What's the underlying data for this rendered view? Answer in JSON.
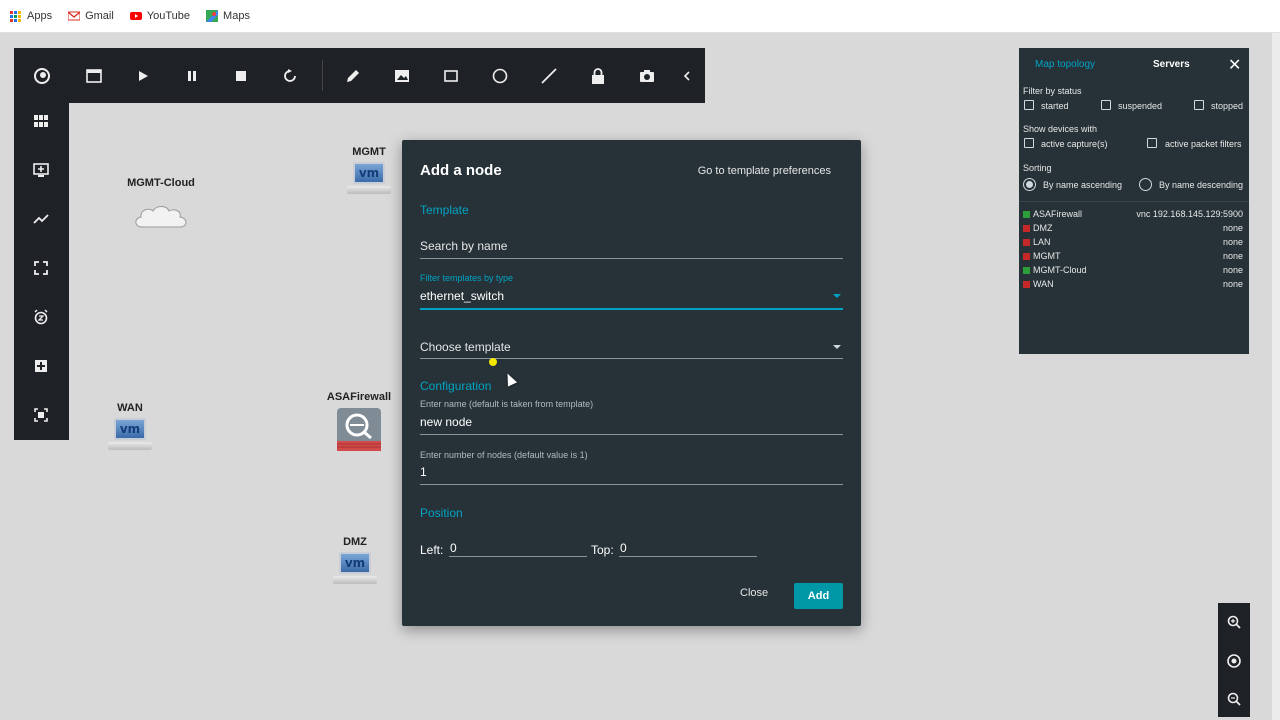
{
  "bookmarks": [
    {
      "label": "Apps",
      "icon": "apps-grid-icon"
    },
    {
      "label": "Gmail",
      "icon": "gmail-icon"
    },
    {
      "label": "YouTube",
      "icon": "youtube-icon"
    },
    {
      "label": "Maps",
      "icon": "maps-icon"
    }
  ],
  "toolbar": {
    "buttons": [
      "gns3-logo-icon",
      "console-window-icon",
      "play-icon",
      "pause-icon",
      "stop-icon",
      "reload-icon",
      "pencil-icon",
      "image-icon",
      "rectangle-icon",
      "ellipse-icon",
      "line-icon",
      "lock-icon",
      "camera-icon",
      "collapse-chevron-icon"
    ]
  },
  "sidebar": {
    "buttons": [
      "devices-grid-icon",
      "add-node-icon",
      "link-icon",
      "fullscreen-icon",
      "alarm-icon",
      "snap-icon",
      "screenshot-frame-icon"
    ]
  },
  "nodes": {
    "mgmt_cloud": "MGMT-Cloud",
    "mgmt": "MGMT",
    "wan": "WAN",
    "asafirewall": "ASAFirewall",
    "dmz": "DMZ",
    "vm_text": "vm"
  },
  "dialog": {
    "title": "Add a node",
    "pref_link": "Go to template preferences",
    "template_section": "Template",
    "search_placeholder": "Search by name",
    "filter_label": "Filter templates by type",
    "filter_value": "ethernet_switch",
    "choose_template": "Choose template",
    "config_section": "Configuration",
    "name_label": "Enter name (default is taken from template)",
    "name_value": "new node",
    "count_label": "Enter number of nodes (default value is 1)",
    "count_value": "1",
    "position_section": "Position",
    "left_label": "Left:",
    "left_value": "0",
    "top_label": "Top:",
    "top_value": "0",
    "close_label": "Close",
    "add_label": "Add"
  },
  "panel": {
    "tab_map": "Map topology",
    "tab_servers": "Servers",
    "filter_status": "Filter by status",
    "started": "started",
    "suspended": "suspended",
    "stopped": "stopped",
    "show_devices": "Show devices with",
    "active_capture": "active capture(s)",
    "active_filters": "active packet filters",
    "sorting": "Sorting",
    "sort_asc": "By name ascending",
    "sort_desc": "By name descending",
    "servers": [
      {
        "name": "ASAFirewall",
        "status": "green",
        "console": "vnc 192.168.145.129:5900"
      },
      {
        "name": "DMZ",
        "status": "red",
        "console": "none"
      },
      {
        "name": "LAN",
        "status": "red",
        "console": "none"
      },
      {
        "name": "MGMT",
        "status": "red",
        "console": "none"
      },
      {
        "name": "MGMT-Cloud",
        "status": "green",
        "console": "none"
      },
      {
        "name": "WAN",
        "status": "red",
        "console": "none"
      }
    ]
  },
  "colors": {
    "accent": "#00a3c4",
    "add_button": "#0097a7",
    "status_green": "#2e9e3a",
    "status_red": "#c62828",
    "dialog_bg": "#263238"
  }
}
